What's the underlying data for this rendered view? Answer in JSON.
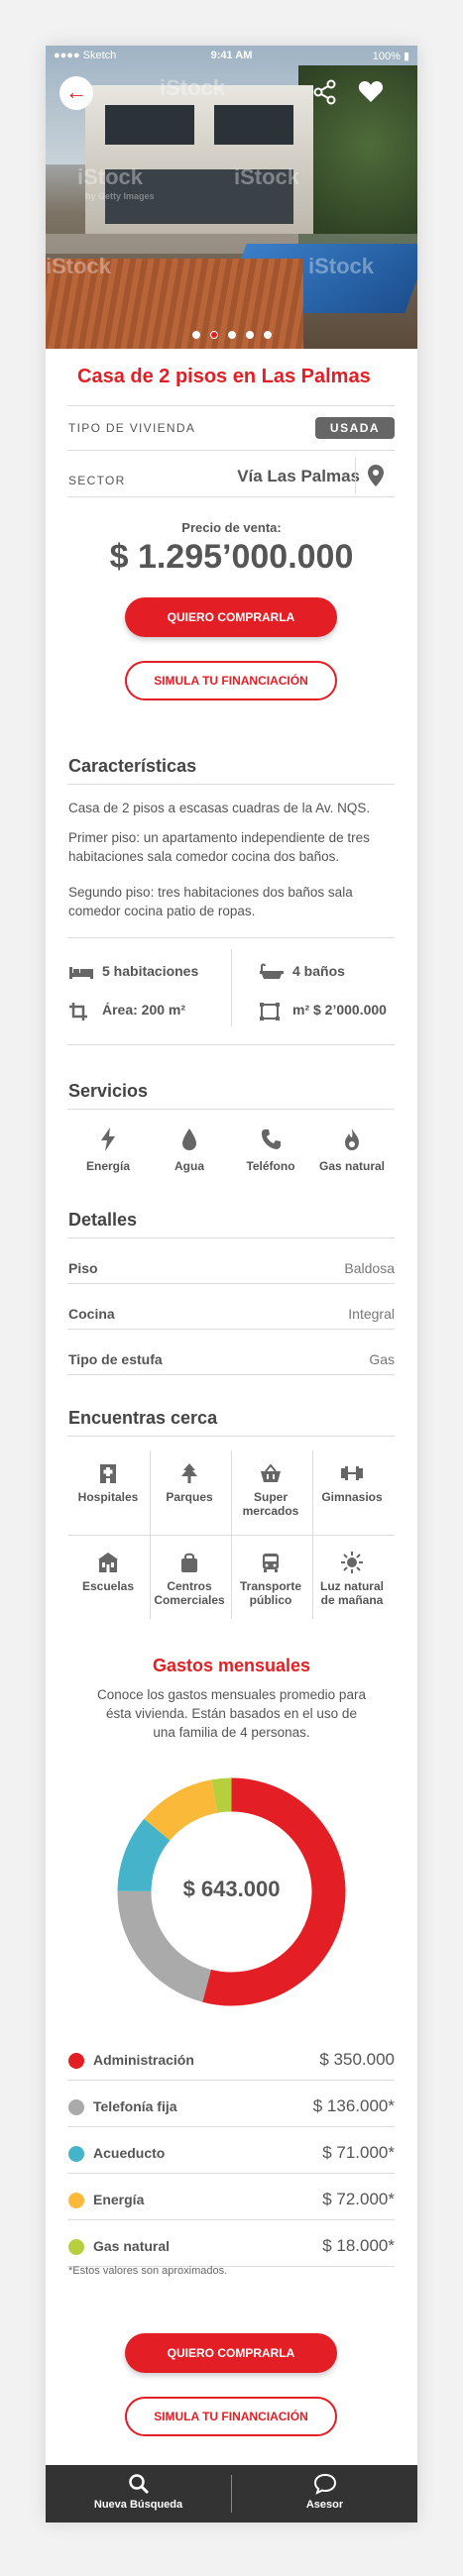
{
  "status_bar": {
    "carrier": "Sketch",
    "time": "9:41 AM",
    "battery": "100%"
  },
  "hero": {
    "watermark": "iStock",
    "watermark_sub": "by Getty Images",
    "slides_total": 5,
    "slide_active": 2
  },
  "listing": {
    "title": "Casa de 2 pisos en Las Palmas",
    "type_label": "TIPO DE VIVIENDA",
    "type_value": "USADA",
    "sector_label": "SECTOR",
    "sector_value": "Vía Las Palmas",
    "price_label": "Precio de venta:",
    "price_value": "$ 1.295’000.000"
  },
  "actions": {
    "buy_label": "QUIERO COMPRARLA",
    "finance_label": "SIMULA TU FINANCIACIÓN"
  },
  "characteristics": {
    "heading": "Características",
    "paragraphs": [
      "Casa de 2 pisos a escasas cuadras de la Av. NQS.",
      "Primer piso: un apartamento independiente de tres habitaciones sala comedor cocina dos baños.",
      "Segundo piso: tres habitaciones dos baños sala comedor cocina patio de ropas."
    ],
    "features": [
      {
        "icon": "bed-icon",
        "label": "5 habitaciones"
      },
      {
        "icon": "bathtub-icon",
        "label": "4 baños"
      },
      {
        "icon": "crop-area-icon",
        "label": "Área: 200 m²"
      },
      {
        "icon": "ruler-square-icon",
        "label": "m² $ 2’000.000"
      }
    ]
  },
  "services": {
    "heading": "Servicios",
    "items": [
      {
        "icon": "lightning-icon",
        "label": "Energía"
      },
      {
        "icon": "water-drop-icon",
        "label": "Agua"
      },
      {
        "icon": "phone-icon",
        "label": "Teléfono"
      },
      {
        "icon": "flame-icon",
        "label": "Gas natural"
      }
    ]
  },
  "details": {
    "heading": "Detalles",
    "rows": [
      {
        "label": "Piso",
        "value": "Baldosa"
      },
      {
        "label": "Cocina",
        "value": "Integral"
      },
      {
        "label": "Tipo de estufa",
        "value": "Gas"
      }
    ]
  },
  "nearby": {
    "heading": "Encuentras cerca",
    "items": [
      {
        "icon": "hospital-icon",
        "label": "Hospitales"
      },
      {
        "icon": "tree-icon",
        "label": "Parques"
      },
      {
        "icon": "basket-icon",
        "label": "Super mercados"
      },
      {
        "icon": "dumbbell-icon",
        "label": "Gimnasios"
      },
      {
        "icon": "school-icon",
        "label": "Escuelas"
      },
      {
        "icon": "bag-icon",
        "label": "Centros Comerciales"
      },
      {
        "icon": "bus-icon",
        "label": "Transporte público"
      },
      {
        "icon": "sun-icon",
        "label": "Luz natural de mañana"
      }
    ]
  },
  "expenses": {
    "heading": "Gastos mensuales",
    "description": "Conoce los gastos mensuales promedio para ésta vivienda. Están basados en el uso de una familia de 4 personas.",
    "total": "$ 643.000",
    "note": "*Estos valores son aproximados.",
    "chart_data": {
      "type": "pie",
      "categories": [
        "Administración",
        "Telefonía fija",
        "Acueducto",
        "Energía",
        "Gas natural"
      ],
      "values": [
        350000,
        136000,
        71000,
        72000,
        18000
      ],
      "display_values": [
        "$ 350.000",
        "$ 136.000*",
        "$ 71.000*",
        "$ 72.000*",
        "$ 18.000*"
      ],
      "colors": [
        "#e31e24",
        "#aaaaaa",
        "#45b3c9",
        "#fbb93a",
        "#b5cf3d"
      ]
    }
  },
  "tabbar": {
    "search_label": "Nueva Búsqueda",
    "advisor_label": "Asesor"
  }
}
